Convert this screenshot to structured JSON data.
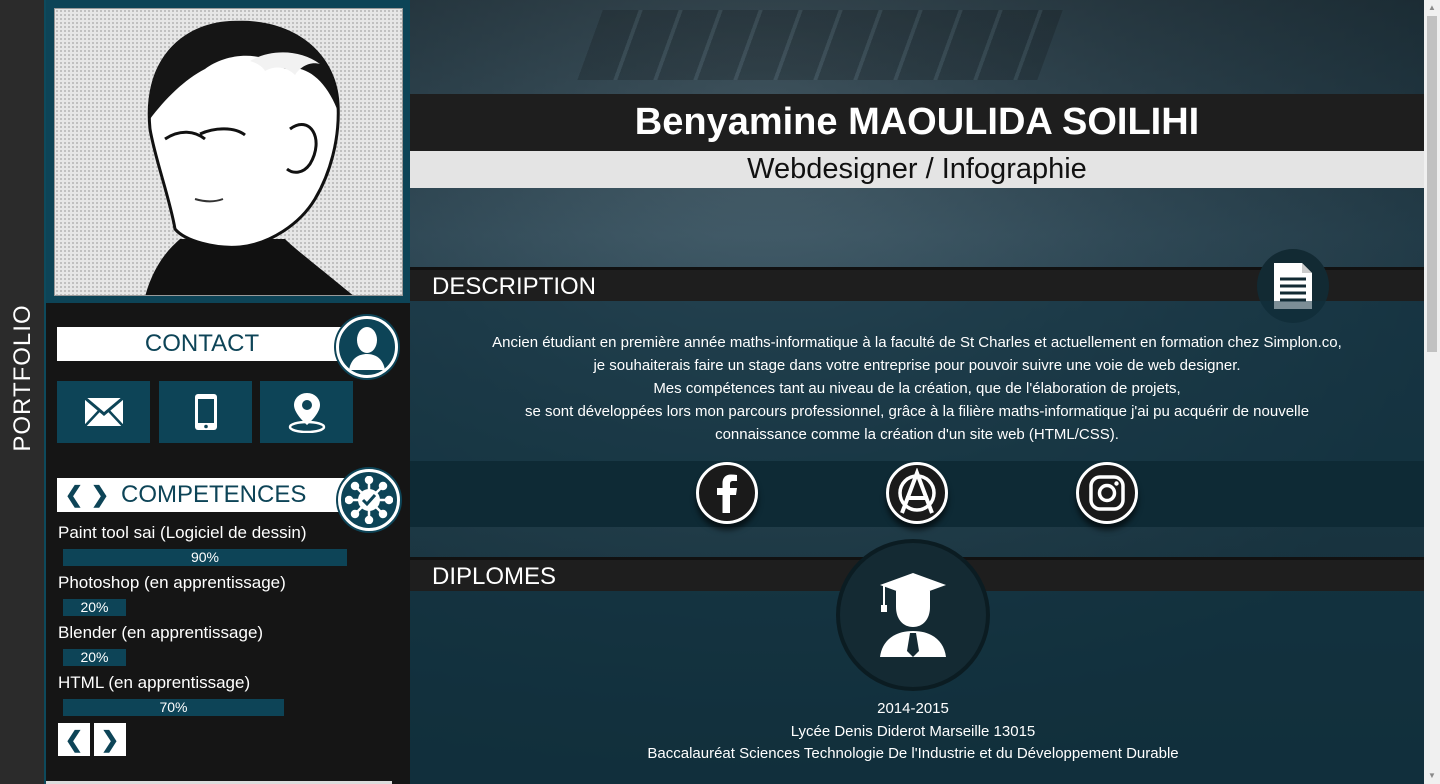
{
  "sidebar": {
    "label": "PORTFOLIO"
  },
  "profile": {
    "name": "Benyamine MAOULIDA SOILIHI",
    "role": "Webdesigner / Infographie"
  },
  "contact": {
    "title": "CONTACT",
    "buttons": [
      {
        "icon": "mail-icon"
      },
      {
        "icon": "phone-icon"
      },
      {
        "icon": "location-icon"
      }
    ]
  },
  "skills": {
    "title": "COMPETENCES",
    "prev": "❮",
    "next": "❯",
    "items": [
      {
        "label": "Paint tool sai (Logiciel de dessin)",
        "value": 90,
        "text": "90%"
      },
      {
        "label": "Photoshop (en apprentissage)",
        "value": 20,
        "text": "20%"
      },
      {
        "label": "Blender (en apprentissage)",
        "value": 20,
        "text": "20%"
      },
      {
        "label": "HTML (en apprentissage)",
        "value": 70,
        "text": "70%"
      }
    ]
  },
  "description": {
    "title": "DESCRIPTION",
    "lines": [
      "Ancien étudiant en première année maths-informatique à la faculté de St Charles et actuellement en formation chez Simplon.co,",
      "je souhaiterais faire un stage dans votre entreprise pour pouvoir suivre une voie de web designer.",
      "Mes compétences tant au niveau de la création, que de l'élaboration de projets,",
      "se sont développées lors mon parcours professionnel, grâce à la filière maths-informatique j'ai pu acquérir de nouvelle",
      "connaissance comme la création d'un site web (HTML/CSS)."
    ]
  },
  "social": [
    {
      "icon": "facebook-icon"
    },
    {
      "icon": "anarchy-logo-icon"
    },
    {
      "icon": "instagram-icon"
    }
  ],
  "diplomas": {
    "title": "DIPLOMES",
    "entry": {
      "years": "2014-2015",
      "school": "Lycée Denis Diderot Marseille 13015",
      "degree": "Baccalauréat Sciences Technologie De l'Industrie et du Développement Durable"
    }
  },
  "colors": {
    "accent": "#0d4457",
    "dark": "#1e1e1e",
    "panel": "#151515"
  }
}
